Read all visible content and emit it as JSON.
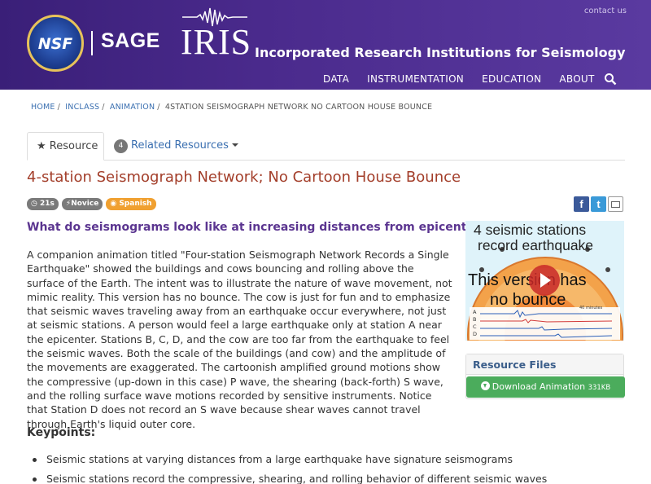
{
  "header": {
    "nsf_logo_text": "NSF",
    "sage_label": "SAGE",
    "iris_label": "IRIS",
    "iris_full_name": "Incorporated Research Institutions for Seismology",
    "contact_link": "contact us",
    "nav": [
      "DATA",
      "INSTRUMENTATION",
      "EDUCATION",
      "ABOUT"
    ],
    "colors": {
      "band": "#4a2a8c",
      "text": "#ffffff"
    }
  },
  "breadcrumb": {
    "items": [
      "HOME",
      "INCLASS",
      "ANIMATION"
    ],
    "current": "4STATION SEISMOGRAPH NETWORK NO CARTOON HOUSE BOUNCE"
  },
  "tabs": {
    "resource_label": "Resource",
    "related_label": "Related Resources",
    "related_count": "4"
  },
  "page": {
    "title": "4-station Seismograph Network; No Cartoon House Bounce",
    "labels": [
      {
        "icon": "clock-icon",
        "text": "21s"
      },
      {
        "icon": "bolt-icon",
        "text": "Novice"
      },
      {
        "icon": "globe-icon",
        "text": "Spanish"
      }
    ],
    "question": "What do seismograms look like at increasing distances from epicenter?",
    "body": "A companion animation titled \"Four-station Seismograph Network Records a Single Earthquake\" showed the buildings and cows bouncing and rolling above the surface of the Earth. The intent was to illustrate the nature of wave movement, not mimic reality. This version has no bounce. The cow is just for fun and to emphasize that seismic waves traveling away from an earthquake occur everywhere, not just at seismic stations. A person would feel a large earthquake only at station A near the epicenter. Stations B, C, D, and the cow are too far from the earthquake to feel the seismic waves. Both the scale of the buildings (and cow) and the amplitude of the movements are exaggerated. The cartoonish amplified ground motions show the compressive (up-down in this case) P wave, the shearing (back-forth) S wave, and the rolling surface wave motions recorded by sensitive instruments. Notice that Station D does not record an S wave because shear waves cannot travel through Earth's liquid outer core.",
    "keypoints_heading": "Keypoints:",
    "keypoints": [
      "Seismic stations at varying distances from a large earthquake have signature seismograms",
      "Seismic stations record the compressive, shearing, and rolling behavior of different seismic waves"
    ]
  },
  "thumbnail": {
    "line1": "4 seismic stations",
    "line2": "record  earthquake",
    "line3": "This version has",
    "line4": "no bounce",
    "station_labels": [
      "A",
      "B",
      "C",
      "D"
    ],
    "axis_label": "40 minutes"
  },
  "resource_files": {
    "heading": "Resource Files",
    "download_label": "Download Animation",
    "download_size": "331KB"
  },
  "share": {
    "facebook": "f",
    "twitter": "t"
  }
}
